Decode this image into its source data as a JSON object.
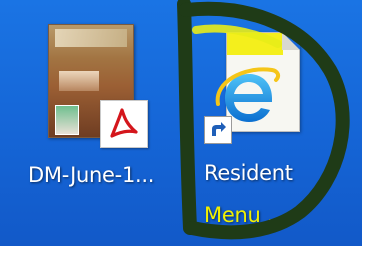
{
  "desktop": {
    "background_color": "#1767d8",
    "icons": [
      {
        "label": "DM-June-1...",
        "type": "pdf-file",
        "badge_icon": "adobe-pdf-icon"
      },
      {
        "label_line1": "Resident",
        "label_line2": "Menu ...",
        "type": "internet-shortcut",
        "app_icon": "internet-explorer-icon",
        "overlay_icon": "shortcut-arrow-icon",
        "label_highlight_color": "#f2f000"
      }
    ]
  },
  "annotation": {
    "shape": "hand-drawn-letter-D",
    "color": "#1f3b17"
  }
}
